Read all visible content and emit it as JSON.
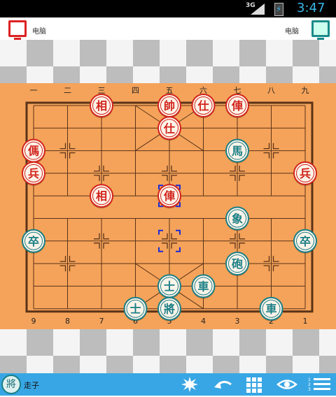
{
  "status_bar": {
    "network": "3G",
    "time": "3:47"
  },
  "top_bar": {
    "player_left_label": "电脑",
    "player_right_label": "电脑"
  },
  "board": {
    "top_files": [
      "一",
      "二",
      "三",
      "四",
      "五",
      "六",
      "七",
      "八",
      "九"
    ],
    "bottom_files": [
      "9",
      "8",
      "7",
      "6",
      "5",
      "4",
      "3",
      "2",
      "1"
    ],
    "colors": {
      "board": "#f5a35a",
      "line": "#5a3318",
      "red": "#d2231b",
      "teal": "#1a7f86",
      "piece_face": "#fdf4ea",
      "select": "#1a2ad8"
    },
    "pieces": [
      {
        "side": "red",
        "char": "相",
        "file": 3,
        "rank": 0
      },
      {
        "side": "red",
        "char": "帥",
        "file": 5,
        "rank": 0
      },
      {
        "side": "red",
        "char": "仕",
        "file": 6,
        "rank": 0
      },
      {
        "side": "red",
        "char": "俥",
        "file": 7,
        "rank": 0
      },
      {
        "side": "red",
        "char": "仕",
        "file": 5,
        "rank": 1
      },
      {
        "side": "red",
        "char": "傌",
        "file": 1,
        "rank": 2
      },
      {
        "side": "red",
        "char": "兵",
        "file": 1,
        "rank": 3
      },
      {
        "side": "red",
        "char": "兵",
        "file": 9,
        "rank": 3
      },
      {
        "side": "red",
        "char": "相",
        "file": 3,
        "rank": 4
      },
      {
        "side": "red",
        "char": "俥",
        "file": 5,
        "rank": 4
      },
      {
        "side": "teal",
        "char": "馬",
        "file": 7,
        "rank": 2
      },
      {
        "side": "teal",
        "char": "象",
        "file": 7,
        "rank": 5
      },
      {
        "side": "teal",
        "char": "卒",
        "file": 1,
        "rank": 6
      },
      {
        "side": "teal",
        "char": "卒",
        "file": 9,
        "rank": 6
      },
      {
        "side": "teal",
        "char": "砲",
        "file": 7,
        "rank": 7
      },
      {
        "side": "teal",
        "char": "士",
        "file": 5,
        "rank": 8
      },
      {
        "side": "teal",
        "char": "車",
        "file": 6,
        "rank": 8
      },
      {
        "side": "teal",
        "char": "士",
        "file": 4,
        "rank": 9
      },
      {
        "side": "teal",
        "char": "將",
        "file": 5,
        "rank": 9
      },
      {
        "side": "teal",
        "char": "車",
        "file": 8,
        "rank": 9
      }
    ],
    "last_move_from": {
      "file": 5,
      "rank": 6
    },
    "last_move_to": {
      "file": 5,
      "rank": 4
    }
  },
  "bottom_bar": {
    "turn_piece_char": "將",
    "turn_label": "走子",
    "buttons": [
      {
        "name": "hint-button",
        "icon": "burst-icon"
      },
      {
        "name": "undo-button",
        "icon": "undo-arrow-icon"
      },
      {
        "name": "board-grid-button",
        "icon": "grid-icon"
      },
      {
        "name": "view-button",
        "icon": "eye-icon"
      },
      {
        "name": "menu-button",
        "icon": "numbered-list-icon"
      }
    ]
  }
}
